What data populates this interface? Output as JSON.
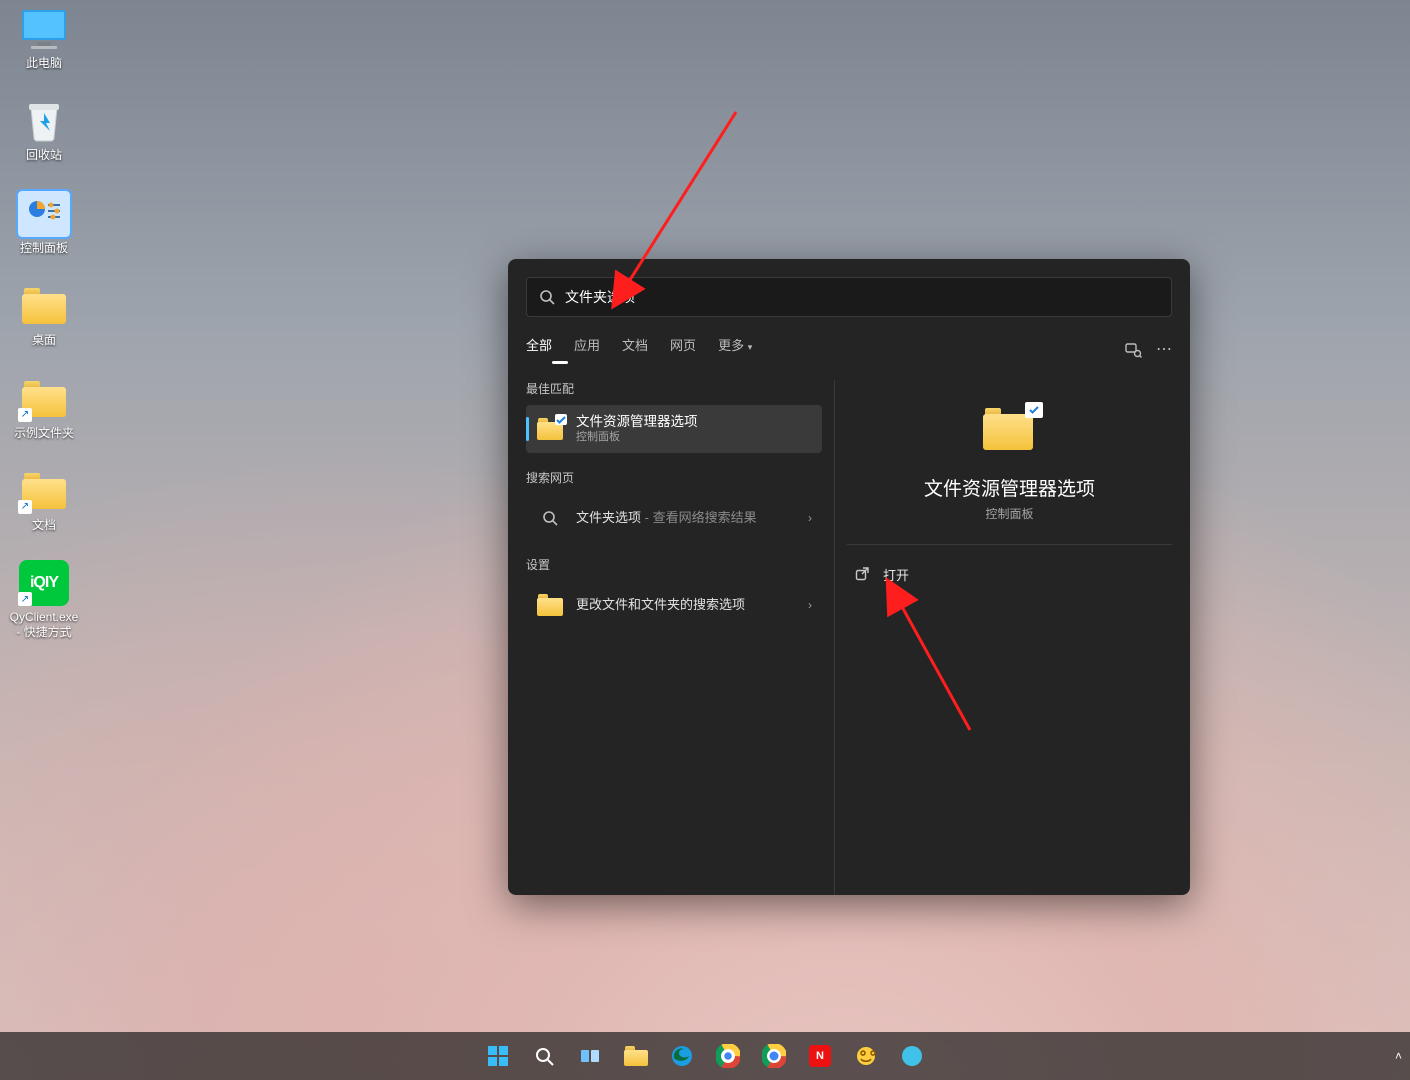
{
  "desktop": {
    "icons": [
      {
        "label": "此电脑",
        "kind": "this-pc"
      },
      {
        "label": "回收站",
        "kind": "recycle-bin"
      },
      {
        "label": "控制面板",
        "kind": "control-panel"
      },
      {
        "label": "桌面",
        "kind": "folder"
      },
      {
        "label": "示例文件夹",
        "kind": "folder-shortcut"
      },
      {
        "label": "文档",
        "kind": "folder-shortcut"
      },
      {
        "label": "QyClient.exe - 快捷方式",
        "kind": "iqiyi-shortcut"
      }
    ]
  },
  "search": {
    "query": "文件夹选项",
    "tabs": [
      "全部",
      "应用",
      "文档",
      "网页",
      "更多"
    ],
    "active_tab": "全部",
    "sections": {
      "best_match": "最佳匹配",
      "web": "搜索网页",
      "settings": "设置"
    },
    "best_match": {
      "title": "文件资源管理器选项",
      "subtitle": "控制面板"
    },
    "web_row": {
      "term": "文件夹选项",
      "hint": " - 查看网络搜索结果"
    },
    "settings_row": {
      "title": "更改文件和文件夹的搜索选项"
    },
    "preview": {
      "title": "文件资源管理器选项",
      "subtitle": "控制面板",
      "action_open": "打开"
    }
  },
  "taskbar": {
    "items": [
      "start",
      "search",
      "task-view",
      "explorer",
      "edge",
      "chrome",
      "chrome2",
      "app1",
      "app2",
      "app3"
    ]
  }
}
